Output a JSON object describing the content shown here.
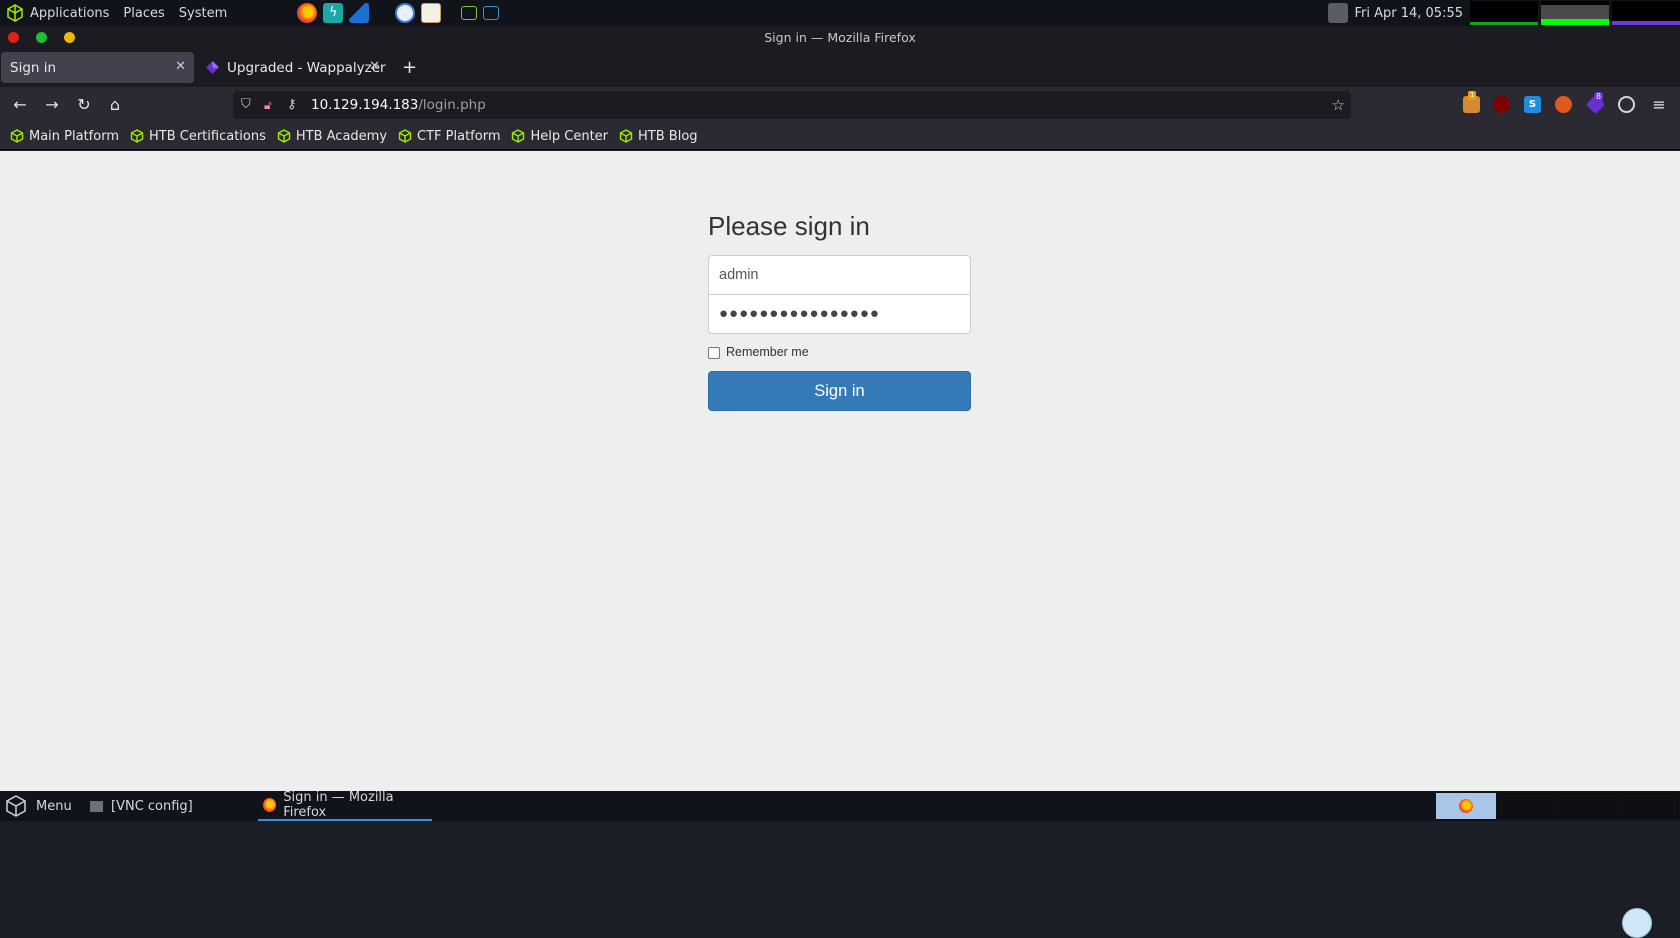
{
  "top_panel": {
    "menus": [
      "Applications",
      "Places",
      "System"
    ],
    "launchers": [
      "firefox-icon",
      "burpsuite-icon",
      "wireshark-icon",
      "owasp-zap-icon",
      "text-editor-icon",
      "terminal-icon",
      "powershell-terminal-icon"
    ],
    "datetime": "Fri Apr 14, 05:55"
  },
  "window": {
    "title": "Sign in — Mozilla Firefox"
  },
  "tabs": [
    {
      "label": "Sign in",
      "active": true
    },
    {
      "label": "Upgraded - Wappalyzer",
      "active": false
    }
  ],
  "urlbar": {
    "host": "10.129.194.183",
    "path": "/login.php"
  },
  "extensions": {
    "badge1": "1",
    "badge2": "8"
  },
  "bookmarks": [
    "Main Platform",
    "HTB Certifications",
    "HTB Academy",
    "CTF Platform",
    "Help Center",
    "HTB Blog"
  ],
  "form": {
    "heading": "Please sign in",
    "username_value": "admin",
    "password_mask": "●●●●●●●●●●●●●●●●",
    "remember_label": "Remember me",
    "remember_checked": false,
    "submit_label": "Sign in"
  },
  "taskbar": {
    "menu_label": "Menu",
    "tasks": [
      "[VNC config]",
      "Sign in — Mozilla Firefox"
    ]
  },
  "colors": {
    "accent": "#337ab7",
    "htb_green": "#9fef00",
    "page_bg": "#eeeeee"
  }
}
